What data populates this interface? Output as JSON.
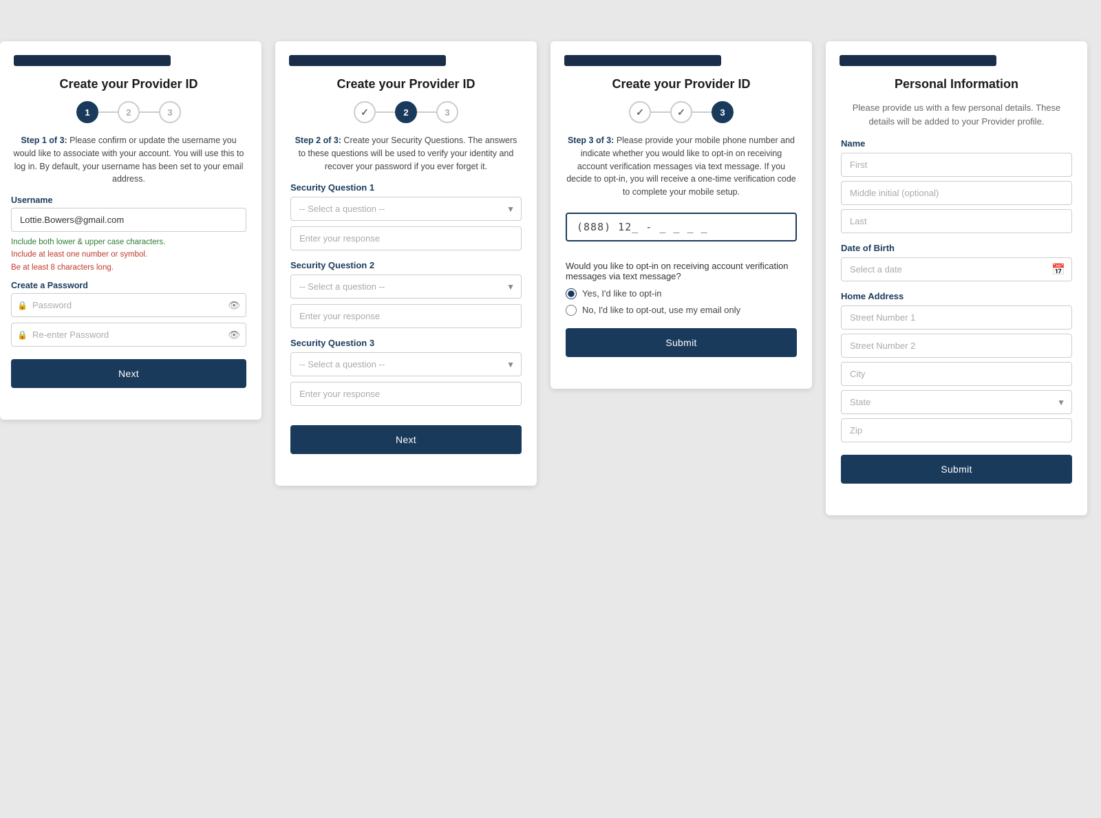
{
  "card1": {
    "header_bar": "",
    "title": "Create your Provider ID",
    "steps": [
      {
        "number": "1",
        "state": "active"
      },
      {
        "number": "2",
        "state": "default"
      },
      {
        "number": "3",
        "state": "default"
      }
    ],
    "description_prefix": "Step 1 of 3:",
    "description_body": " Please confirm or update the username you would like to associate with your account. You will use this to log in. By default, your username has been set to your email address.",
    "username_label": "Username",
    "username_value": "Lottie.Bowers@gmail.com",
    "validation": [
      {
        "text": "Include both lower & upper case characters.",
        "type": "green"
      },
      {
        "text": "Include at least one number or symbol.",
        "type": "red"
      },
      {
        "text": "Be at least 8 characters long.",
        "type": "red"
      }
    ],
    "create_password_label": "Create a Password",
    "password_placeholder": "Password",
    "reenter_placeholder": "Re-enter Password",
    "next_label": "Next"
  },
  "card2": {
    "title": "Create your Provider ID",
    "steps": [
      {
        "state": "completed"
      },
      {
        "number": "2",
        "state": "active"
      },
      {
        "number": "3",
        "state": "default"
      }
    ],
    "description_prefix": "Step 2 of 3:",
    "description_body": " Create your Security Questions. The answers to these questions will be used to verify your identity and recover your password if you ever forget it.",
    "questions": [
      {
        "label": "Security Question 1",
        "select_placeholder": "-- Select a question --",
        "response_placeholder": "Enter your response"
      },
      {
        "label": "Security Question 2",
        "select_placeholder": "-- Select a question --",
        "response_placeholder": "Enter your response"
      },
      {
        "label": "Security Question 3",
        "select_placeholder": "-- Select a question --",
        "response_placeholder": "Enter your response"
      }
    ],
    "next_label": "Next"
  },
  "card3": {
    "title": "Create your Provider ID",
    "steps": [
      {
        "state": "completed"
      },
      {
        "state": "completed"
      },
      {
        "number": "3",
        "state": "active"
      }
    ],
    "description_prefix": "Step 3 of 3:",
    "description_body": " Please provide your mobile phone number and indicate whether you would like to opt-in on receiving account verification messages via text message. If you decide to opt-in, you will receive a one-time verification code to complete your mobile setup.",
    "phone_value": "(888) 12_ - _ _ _ _",
    "opt_in_question": "Would you like to opt-in on receiving account verification messages via text message?",
    "opt_yes": "Yes, I'd like to opt-in",
    "opt_no": "No, I'd like to opt-out, use my email only",
    "submit_label": "Submit"
  },
  "card4": {
    "title": "Personal Information",
    "subtitle": "Please provide us with a few personal details. These details will be added to your Provider profile.",
    "name_label": "Name",
    "first_placeholder": "First",
    "middle_placeholder": "Middle initial (optional)",
    "last_placeholder": "Last",
    "dob_label": "Date of Birth",
    "dob_placeholder": "Select a date",
    "address_label": "Home Address",
    "street1_placeholder": "Street Number 1",
    "street2_placeholder": "Street Number 2",
    "city_placeholder": "City",
    "state_placeholder": "State",
    "zip_placeholder": "Zip",
    "submit_label": "Submit"
  }
}
